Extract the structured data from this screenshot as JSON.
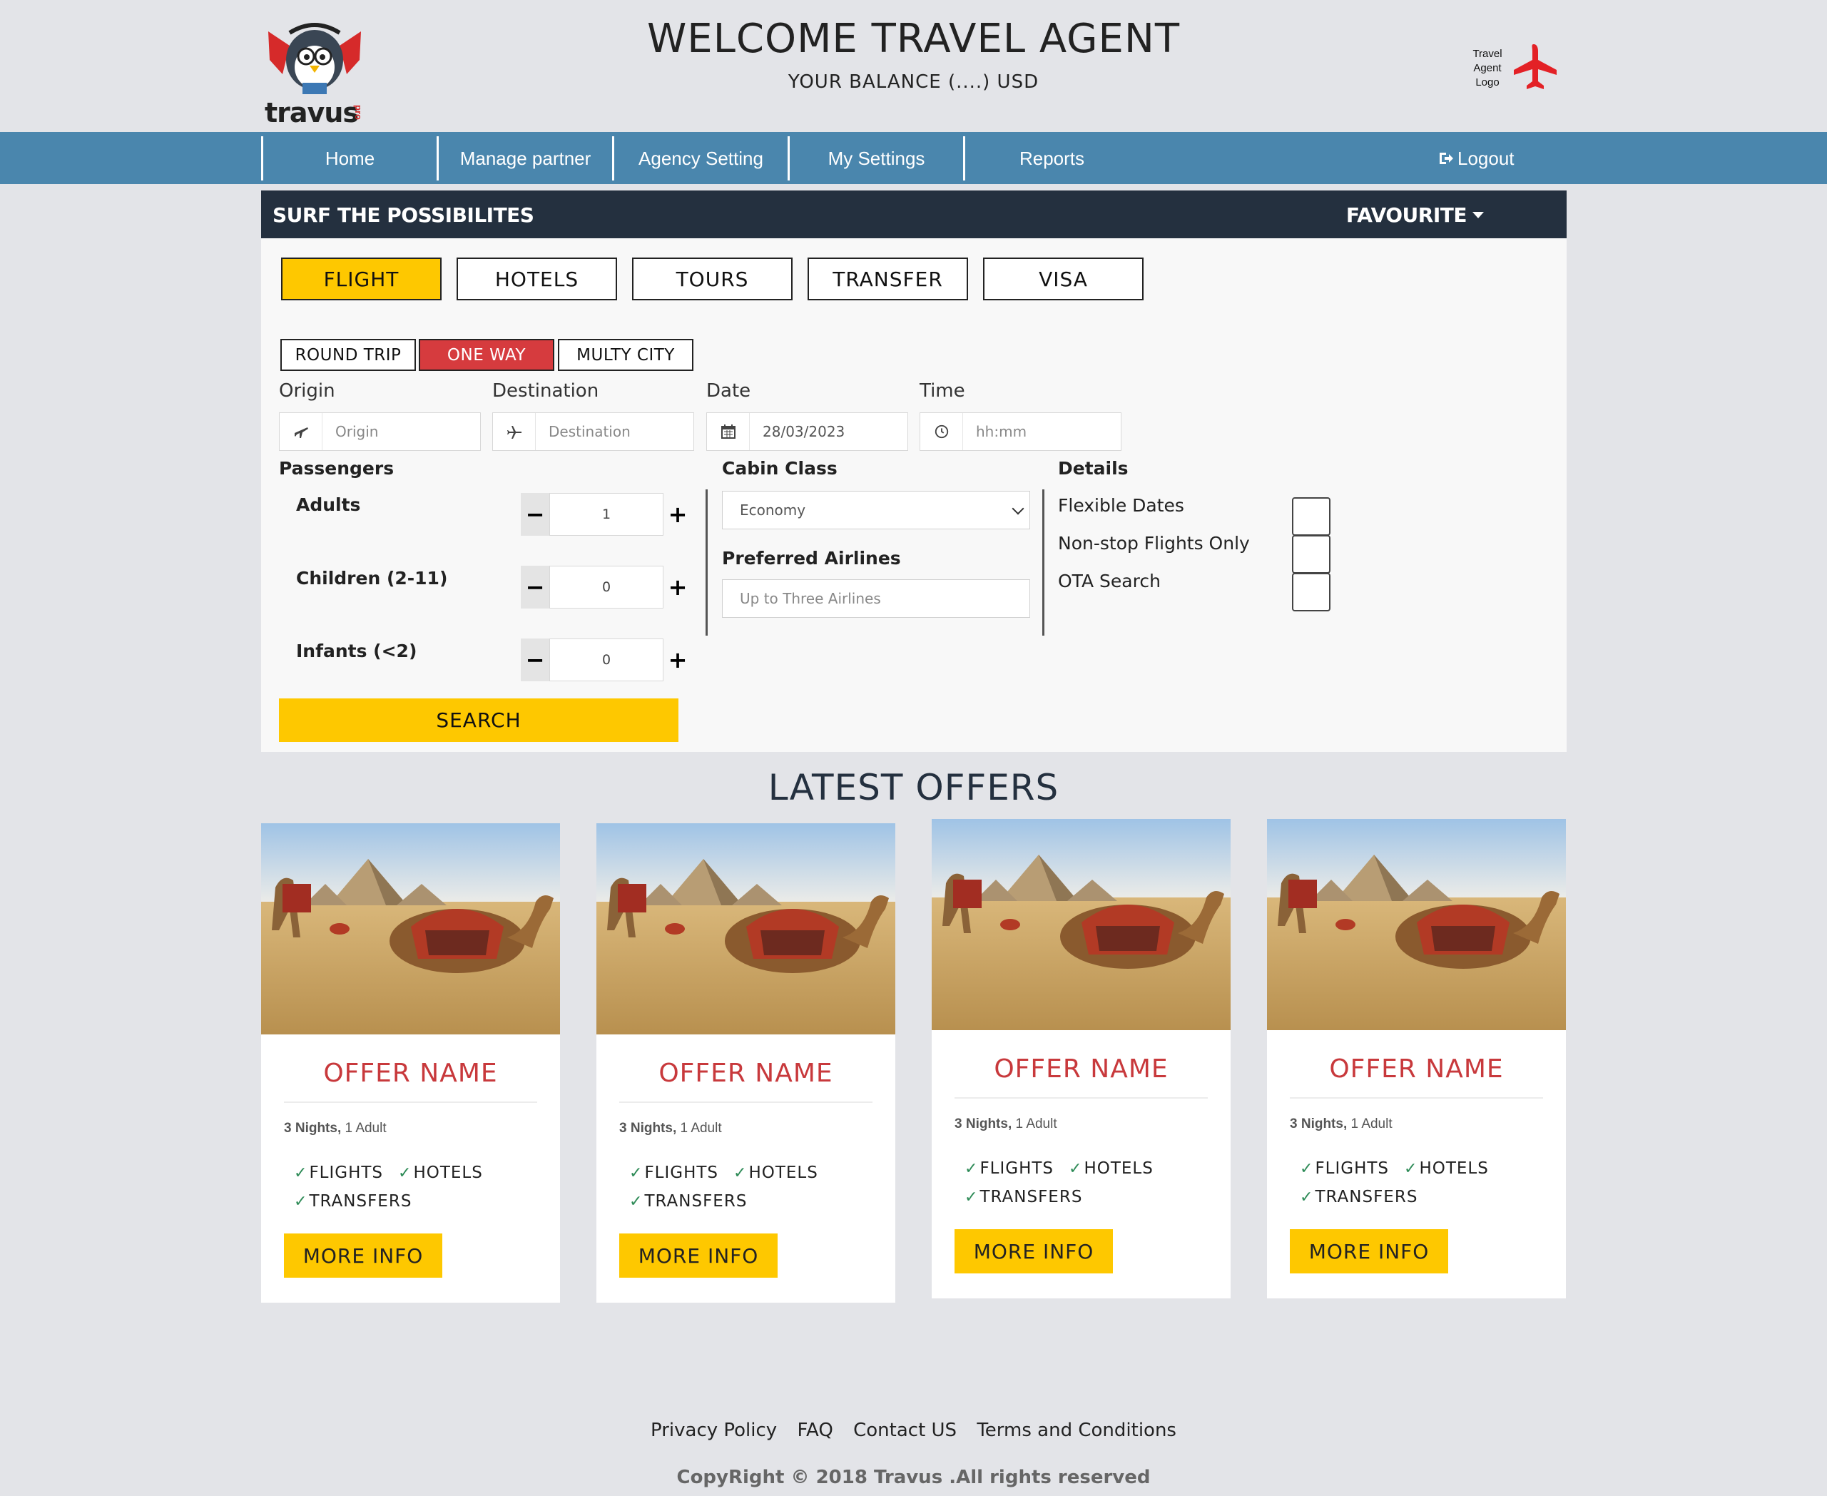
{
  "header": {
    "brand": "travus",
    "brand_suffix": "pro",
    "title": "WELCOME TRAVEL AGENT",
    "balance": "YOUR BALANCE (....) USD",
    "agent_logo_text": "Travel Agent Logo"
  },
  "nav": {
    "items": [
      "Home",
      "Manage partner",
      "Agency Setting",
      "My Settings",
      "Reports"
    ],
    "logout": "Logout"
  },
  "search": {
    "panel_title": "SURF THE POSSIBILITES",
    "favourite": "FAVOURITE",
    "tabs": [
      "FLIGHT",
      "HOTELS",
      "TOURS",
      "TRANSFER",
      "VISA"
    ],
    "active_tab": "FLIGHT",
    "trip_types": [
      "ROUND TRIP",
      "ONE WAY",
      "MULTY CITY"
    ],
    "active_trip": "ONE WAY",
    "origin": {
      "label": "Origin",
      "placeholder": "Origin"
    },
    "destination": {
      "label": "Destination",
      "placeholder": "Destination"
    },
    "date": {
      "label": "Date",
      "value": "28/03/2023"
    },
    "time": {
      "label": "Time",
      "placeholder": "hh:mm"
    },
    "passengers": {
      "label": "Passengers",
      "adults": {
        "label": "Adults",
        "value": "1"
      },
      "children": {
        "label": "Children (2-11)",
        "value": "0"
      },
      "infants": {
        "label": "Infants (<2)",
        "value": "0"
      }
    },
    "cabin": {
      "label": "Cabin Class",
      "value": "Economy"
    },
    "airlines": {
      "label": "Preferred Airlines",
      "placeholder": "Up to Three Airlines"
    },
    "details": {
      "label": "Details",
      "flexible": "Flexible Dates",
      "nonstop": "Non-stop Flights Only",
      "ota": "OTA Search"
    },
    "search_button": "SEARCH"
  },
  "offers": {
    "title": "LATEST OFFERS",
    "cards": [
      {
        "name": "OFFER NAME",
        "nights": "3 Nights,",
        "adults": "1 Adult",
        "flights": "FLIGHTS",
        "hotels": "HOTELS",
        "transfers": "TRANSFERS",
        "button": "MORE INFO"
      },
      {
        "name": "OFFER NAME",
        "nights": "3 Nights,",
        "adults": "1 Adult",
        "flights": "FLIGHTS",
        "hotels": "HOTELS",
        "transfers": "TRANSFERS",
        "button": "MORE INFO"
      },
      {
        "name": "OFFER NAME",
        "nights": "3 Nights,",
        "adults": "1 Adult",
        "flights": "FLIGHTS",
        "hotels": "HOTELS",
        "transfers": "TRANSFERS",
        "button": "MORE INFO"
      },
      {
        "name": "OFFER NAME",
        "nights": "3 Nights,",
        "adults": "1 Adult",
        "flights": "FLIGHTS",
        "hotels": "HOTELS",
        "transfers": "TRANSFERS",
        "button": "MORE INFO"
      }
    ]
  },
  "footer": {
    "links": [
      "Privacy Policy",
      "FAQ",
      "Contact US",
      "Terms and Conditions"
    ],
    "copyright": "CopyRight © 2018 Travus .All rights reserved"
  },
  "colors": {
    "nav": "#4a86ad",
    "panel_header": "#24303f",
    "accent_yellow": "#fec800",
    "accent_red": "#d63b3e",
    "background": "#e3e4e8"
  }
}
